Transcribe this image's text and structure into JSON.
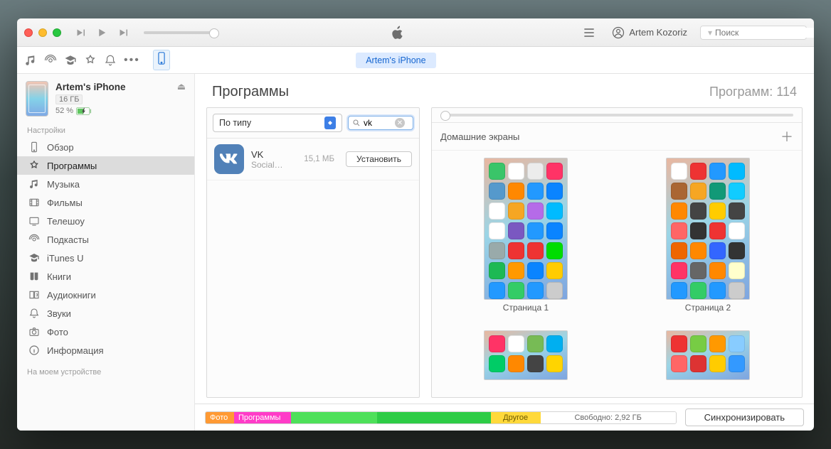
{
  "titlebar": {
    "user_label": "Artem Kozoriz",
    "search_placeholder": "Поиск"
  },
  "tabs": {
    "device_pill": "Artem's iPhone"
  },
  "sidebar": {
    "device": {
      "name": "Artem's iPhone",
      "capacity": "16 ГБ",
      "battery": "52 %"
    },
    "section_settings": "Настройки",
    "section_ondevice": "На моем устройстве",
    "items": [
      {
        "label": "Обзор"
      },
      {
        "label": "Программы"
      },
      {
        "label": "Музыка"
      },
      {
        "label": "Фильмы"
      },
      {
        "label": "Телешоу"
      },
      {
        "label": "Подкасты"
      },
      {
        "label": "iTunes U"
      },
      {
        "label": "Книги"
      },
      {
        "label": "Аудиокниги"
      },
      {
        "label": "Звуки"
      },
      {
        "label": "Фото"
      },
      {
        "label": "Информация"
      }
    ]
  },
  "main": {
    "title": "Программы",
    "count_label": "Программ: 114",
    "sort_select": "По типу",
    "search_value": "vk",
    "app": {
      "name": "VK",
      "category": "Social…",
      "size": "15,1 МБ",
      "install": "Установить"
    },
    "homescreens_label": "Домашние экраны",
    "pages": [
      "Страница 1",
      "Страница 2"
    ]
  },
  "footer": {
    "photo": "Фото",
    "apps": "Программы",
    "other": "Другое",
    "free": "Свободно: 2,92 ГБ",
    "sync": "Синхронизировать"
  },
  "icon_colors": {
    "p1": [
      "#3ac569",
      "#fff",
      "#ececec",
      "#f36",
      "#59c",
      "#f80",
      "#29f",
      "#0a84ff",
      "#fff",
      "#f6a623",
      "#b56be8",
      "#0bf",
      "#fff",
      "#7a58c1",
      "#29f",
      "#0a84ff",
      "#9aa",
      "#e33",
      "#e33",
      "#0d0",
      "#1db954",
      "#f90",
      "#0a84ff",
      "#fc0",
      "#29f",
      "#3c6",
      "#29f",
      "#ccc"
    ],
    "p2": [
      "#fff",
      "#e33",
      "#29f",
      "#0bf",
      "#a63",
      "#f6a623",
      "#197",
      "#1cf",
      "#f80",
      "#444",
      "#fc0",
      "#444",
      "#f66",
      "#333",
      "#e33",
      "#fff",
      "#e60",
      "#f80",
      "#36f",
      "#333",
      "#f36",
      "#666",
      "#f80",
      "#ffc",
      "#29f",
      "#3c6",
      "#29f",
      "#ccc"
    ],
    "p3": [
      "#f36",
      "#fff",
      "#7b5",
      "#00aff0",
      "#0c6",
      "#f80",
      "#444",
      "#ffd400"
    ],
    "p4": [
      "#e33",
      "#7c4",
      "#f90",
      "#8cf",
      "#f66",
      "#d33",
      "#fc0",
      "#39f"
    ]
  }
}
